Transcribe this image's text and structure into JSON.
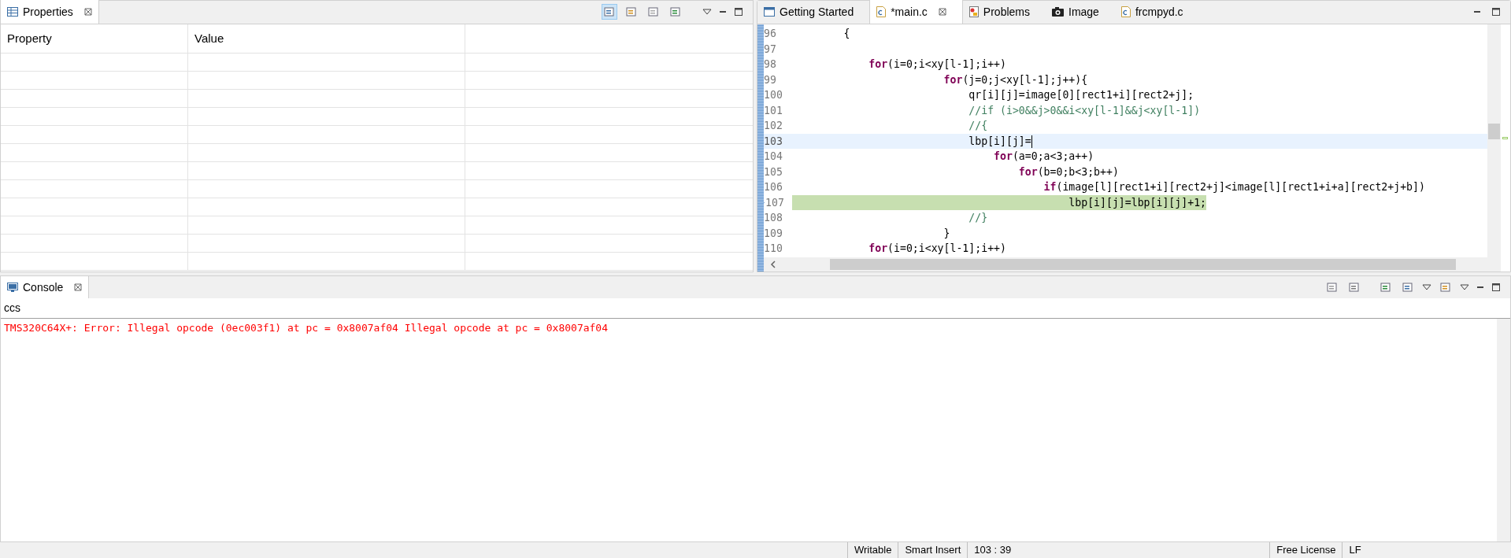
{
  "properties": {
    "title": "Properties",
    "columns": [
      "Property",
      "Value"
    ]
  },
  "editor": {
    "tabs": [
      {
        "label": "Getting Started",
        "kind": "welcome",
        "selected": false
      },
      {
        "label": "*main.c",
        "kind": "cfile",
        "selected": true
      },
      {
        "label": "Problems",
        "kind": "problems",
        "selected": false
      },
      {
        "label": "Image",
        "kind": "camera",
        "selected": false
      },
      {
        "label": "frcmpyd.c",
        "kind": "cfile",
        "selected": false
      }
    ],
    "lines": [
      {
        "number": "96",
        "current": false,
        "executing": false,
        "tokens": [
          {
            "kind": "plain",
            "text": "        {"
          }
        ]
      },
      {
        "number": "97",
        "current": false,
        "executing": false
      },
      {
        "number": "98",
        "current": false,
        "executing": false,
        "tokens": [
          {
            "kind": "keyword",
            "text": "            for"
          },
          {
            "kind": "plain",
            "text": "(i=0;i<xy[l-1];i++)"
          }
        ]
      },
      {
        "number": "99",
        "current": false,
        "executing": false,
        "tokens": [
          {
            "kind": "keyword",
            "text": "                        for"
          },
          {
            "kind": "plain",
            "text": "(j=0;j<xy[l-1];j++){"
          }
        ]
      },
      {
        "number": "100",
        "current": false,
        "executing": false,
        "tokens": [
          {
            "kind": "plain",
            "text": "                            qr[i][j]=image[0][rect1+i][rect2+j];"
          }
        ]
      },
      {
        "number": "101",
        "current": false,
        "executing": false,
        "tokens": [
          {
            "kind": "comment",
            "text": "                            //if (i>0&&j>0&&i<xy[l-1]&&j<xy[l-1])"
          }
        ]
      },
      {
        "number": "102",
        "current": false,
        "executing": false,
        "tokens": [
          {
            "kind": "comment",
            "text": "                            //{"
          }
        ]
      },
      {
        "number": "103",
        "current": true,
        "executing": false,
        "tokens": [
          {
            "kind": "plain",
            "text": "                            lbp[i][j]="
          }
        ]
      },
      {
        "number": "104",
        "current": false,
        "executing": false,
        "tokens": [
          {
            "kind": "keyword",
            "text": "                                for"
          },
          {
            "kind": "plain",
            "text": "(a=0;a<3;a++)"
          }
        ]
      },
      {
        "number": "105",
        "current": false,
        "executing": false,
        "tokens": [
          {
            "kind": "keyword",
            "text": "                                    for"
          },
          {
            "kind": "plain",
            "text": "(b=0;b<3;b++)"
          }
        ]
      },
      {
        "number": "106",
        "current": false,
        "executing": false,
        "tokens": [
          {
            "kind": "keyword",
            "text": "                                        if"
          },
          {
            "kind": "plain",
            "text": "(image[l][rect1+i][rect2+j]<image[l][rect1+i+a][rect2+j+b])"
          }
        ]
      },
      {
        "number": "107",
        "current": false,
        "executing": true,
        "tokens": [
          {
            "kind": "plain",
            "text": "                                            lbp[i][j]=lbp[i][j]+1;"
          }
        ]
      },
      {
        "number": "108",
        "current": false,
        "executing": false,
        "tokens": [
          {
            "kind": "comment",
            "text": "                            //}"
          }
        ]
      },
      {
        "number": "109",
        "current": false,
        "executing": false,
        "tokens": [
          {
            "kind": "plain",
            "text": "                        }"
          }
        ]
      },
      {
        "number": "110",
        "current": false,
        "executing": false,
        "tokens": [
          {
            "kind": "keyword",
            "text": "            for"
          },
          {
            "kind": "plain",
            "text": "(i=0;i<xy[l-1];i++)"
          }
        ]
      }
    ]
  },
  "console": {
    "title": "Console",
    "name": "ccs",
    "output": "TMS320C64X+: Error: Illegal opcode (0ec003f1) at pc = 0x8007af04 Illegal opcode at pc = 0x8007af04"
  },
  "status_bar": [
    "Writable",
    "Smart Insert",
    "103 : 39",
    "Free License",
    "LF"
  ]
}
